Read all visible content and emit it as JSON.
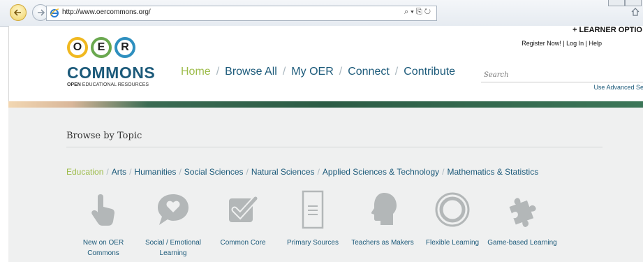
{
  "browser": {
    "url": "http://www.oercommons.org/",
    "address_tools": "⌕ ▾ ⎘ ↻"
  },
  "site": {
    "learner_options": "+ LEARNER OPTIO",
    "account_links": {
      "register": "Register Now!",
      "login": "Log In",
      "help": "Help"
    },
    "logo": {
      "letters": [
        "O",
        "E",
        "R"
      ],
      "wordmark": "COMMONS",
      "tagline_bold": "OPEN",
      "tagline_rest": " EDUCATIONAL RESOURCES"
    },
    "nav": [
      {
        "label": "Home",
        "active": true
      },
      {
        "label": "Browse All"
      },
      {
        "label": "My OER"
      },
      {
        "label": "Connect"
      },
      {
        "label": "Contribute"
      }
    ],
    "nav_separator": "/",
    "search": {
      "placeholder": "Search"
    },
    "advanced_search": "Use Advanced Se"
  },
  "browse": {
    "title": "Browse by Topic",
    "topics": [
      {
        "label": "Education",
        "active": true
      },
      {
        "label": "Arts"
      },
      {
        "label": "Humanities"
      },
      {
        "label": "Social Sciences"
      },
      {
        "label": "Natural Sciences"
      },
      {
        "label": "Applied Sciences & Technology"
      },
      {
        "label": "Mathematics & Statistics"
      }
    ],
    "categories": [
      {
        "icon": "hand-pointer-icon",
        "label": "New on OER Commons"
      },
      {
        "icon": "heart-speech-bubble-icon",
        "label": "Social / Emotional Learning"
      },
      {
        "icon": "checkbox-icon",
        "label": "Common Core"
      },
      {
        "icon": "document-icon",
        "label": "Primary Sources"
      },
      {
        "icon": "head-silhouette-icon",
        "label": "Teachers as Makers"
      },
      {
        "icon": "rings-icon",
        "label": "Flexible Learning"
      },
      {
        "icon": "puzzle-piece-icon",
        "label": "Game-based Learning"
      }
    ]
  },
  "colors": {
    "brand_blue": "#1c5a7a",
    "active_green": "#9dbc4a",
    "icon_gray": "#b3b7b8"
  }
}
